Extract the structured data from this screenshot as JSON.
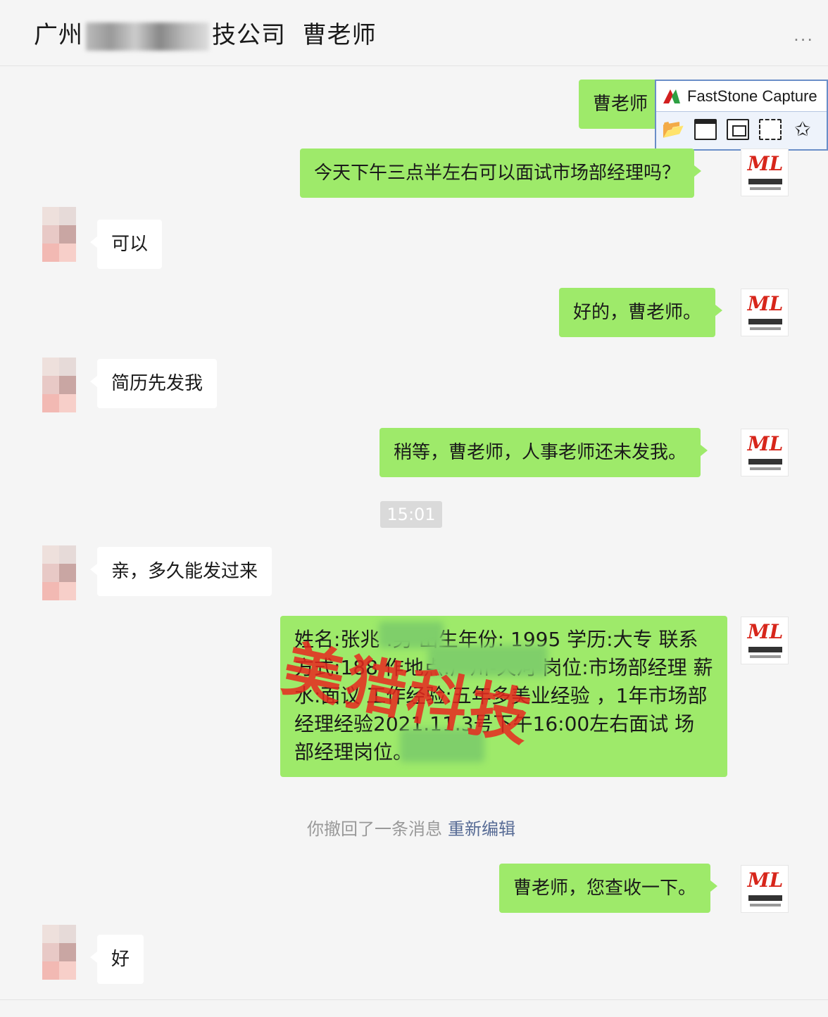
{
  "header": {
    "title_prefix": "广州",
    "title_suffix": "技公司",
    "contact_name": "曹老师",
    "more": "..."
  },
  "faststone": {
    "title": "FastStone Capture"
  },
  "messages": {
    "m1": "曹老师",
    "m2": "今天下午三点半左右可以面试市场部经理吗？",
    "m3": "可以",
    "m4": "好的，曹老师。",
    "m5": "简历先发我",
    "m6": "稍等，曹老师，人事老师还未发我。",
    "timestamp": "15:01",
    "m7": "亲，多久能发过来",
    "m8": "姓名:张兆 :男 出生年份: 1995 学历:大专 联系方式:188 作地点:广州-天河 岗位:市场部经理 薪水:面议 工作经验:五年多美业经验 ，1年市场部经理经验2021.11.3号下午16:00左右面试 场部经理岗位。",
    "watermark": "美猎科技",
    "recall_text": "你撤回了一条消息",
    "recall_link": "重新编辑",
    "m9": "曹老师，您查收一下。",
    "m10": "好"
  },
  "avatars": {
    "me_logo": "ML"
  },
  "colors": {
    "outgoing_bubble": "#9eea6a",
    "incoming_bubble": "#ffffff",
    "background": "#f5f5f5",
    "link": "#576b95",
    "watermark": "#e6281e"
  }
}
